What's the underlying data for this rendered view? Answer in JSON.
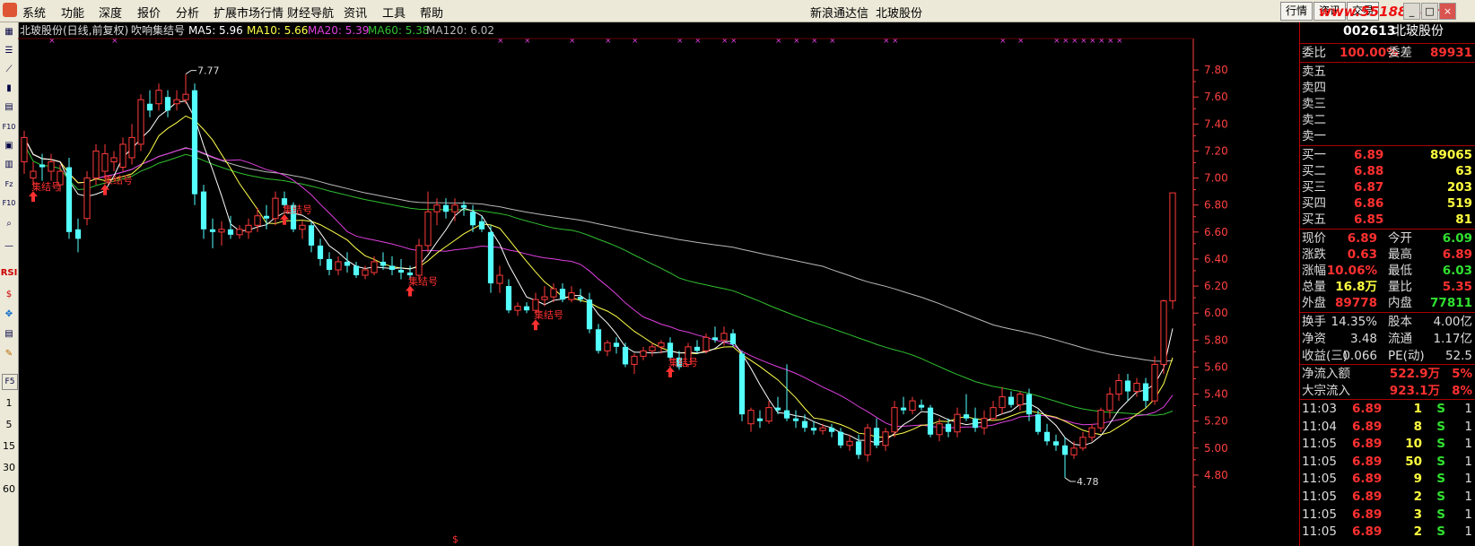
{
  "menu": {
    "items": [
      "系统",
      "功能",
      "深度",
      "报价",
      "分析",
      "扩展市场行情",
      "财经导航",
      "资讯",
      "工具",
      "帮助"
    ],
    "center": [
      "新浪通达信",
      "北玻股份"
    ],
    "right_buttons": [
      "行情",
      "资讯",
      "交易"
    ],
    "watermark": "www.55188.com"
  },
  "toolbar": {
    "icons": [
      "grid-icon",
      "list-icon",
      "line-chart-icon",
      "candle-icon",
      "table-icon",
      "f10-icon",
      "doc-icon",
      "book-icon",
      "f2z-icon",
      "f10b-icon",
      "magnifier-icon",
      "rsi-icon",
      "dollar-icon",
      "move-icon",
      "stack-icon",
      "pencil-icon",
      "f5-icon"
    ],
    "rsi_label": "RSI",
    "periods": [
      "1",
      "5",
      "15",
      "30",
      "60"
    ]
  },
  "chart": {
    "header": {
      "stock": "北玻股份(日线,前复权)",
      "indicator": "吹响集结号",
      "ma5": "MA5: 5.96",
      "ma10": "MA10: 5.66",
      "ma20": "MA20: 5.39",
      "ma60": "MA60: 5.38",
      "ma120": "MA120: 6.02"
    },
    "high_label": "7.77",
    "low_label": "4.78",
    "signal_label": "集结号",
    "dollar_marker": "$",
    "colors": {
      "up": "#ff3a3a",
      "down": "#54ffff",
      "ma5": "#ffffff",
      "ma10": "#ffff4a",
      "ma20": "#e040e0",
      "ma60": "#30c030",
      "ma120": "#b8b8b8",
      "grid": "#5a0000",
      "axis": "#ff4040"
    },
    "y_ticks": [
      "7.80",
      "7.60",
      "7.40",
      "7.20",
      "7.00",
      "6.80",
      "6.60",
      "6.40",
      "6.20",
      "6.00",
      "5.80",
      "5.60",
      "5.40",
      "5.20",
      "5.00",
      "4.80"
    ],
    "signal_days": [
      1,
      9,
      29,
      43,
      57,
      72
    ]
  },
  "chart_data": {
    "type": "candlestick",
    "ylim": [
      4.7,
      7.9
    ],
    "ohlc": [
      [
        7.12,
        7.35,
        7.03,
        7.3
      ],
      [
        7.0,
        7.12,
        6.95,
        7.05
      ],
      [
        7.1,
        7.18,
        6.98,
        7.08
      ],
      [
        7.05,
        7.18,
        6.98,
        7.12
      ],
      [
        6.95,
        7.1,
        6.9,
        7.05
      ],
      [
        7.08,
        7.15,
        6.55,
        6.6
      ],
      [
        6.62,
        6.7,
        6.45,
        6.55
      ],
      [
        6.7,
        7.05,
        6.65,
        7.0
      ],
      [
        7.0,
        7.25,
        6.95,
        7.2
      ],
      [
        7.05,
        7.25,
        7.0,
        7.18
      ],
      [
        7.12,
        7.2,
        7.05,
        7.15
      ],
      [
        7.08,
        7.3,
        7.05,
        7.25
      ],
      [
        7.15,
        7.4,
        7.1,
        7.3
      ],
      [
        7.25,
        7.62,
        7.2,
        7.58
      ],
      [
        7.55,
        7.65,
        7.45,
        7.5
      ],
      [
        7.55,
        7.7,
        7.5,
        7.65
      ],
      [
        7.6,
        7.65,
        7.45,
        7.5
      ],
      [
        7.55,
        7.65,
        7.5,
        7.58
      ],
      [
        7.58,
        7.77,
        7.55,
        7.62
      ],
      [
        7.65,
        7.7,
        6.8,
        6.88
      ],
      [
        6.9,
        6.95,
        6.55,
        6.62
      ],
      [
        6.62,
        6.7,
        6.48,
        6.6
      ],
      [
        6.6,
        6.68,
        6.5,
        6.62
      ],
      [
        6.62,
        6.72,
        6.55,
        6.58
      ],
      [
        6.58,
        6.65,
        6.55,
        6.62
      ],
      [
        6.6,
        6.7,
        6.55,
        6.65
      ],
      [
        6.65,
        6.78,
        6.6,
        6.72
      ],
      [
        6.72,
        6.8,
        6.62,
        6.7
      ],
      [
        6.7,
        6.9,
        6.65,
        6.85
      ],
      [
        6.85,
        6.9,
        6.78,
        6.8
      ],
      [
        6.8,
        6.82,
        6.6,
        6.62
      ],
      [
        6.62,
        6.68,
        6.55,
        6.65
      ],
      [
        6.65,
        6.68,
        6.45,
        6.5
      ],
      [
        6.5,
        6.55,
        6.35,
        6.4
      ],
      [
        6.4,
        6.45,
        6.28,
        6.32
      ],
      [
        6.32,
        6.42,
        6.28,
        6.38
      ],
      [
        6.38,
        6.45,
        6.3,
        6.35
      ],
      [
        6.35,
        6.38,
        6.26,
        6.28
      ],
      [
        6.28,
        6.35,
        6.25,
        6.32
      ],
      [
        6.3,
        6.42,
        6.28,
        6.38
      ],
      [
        6.38,
        6.45,
        6.32,
        6.35
      ],
      [
        6.35,
        6.42,
        6.28,
        6.32
      ],
      [
        6.32,
        6.4,
        6.25,
        6.3
      ],
      [
        6.3,
        6.35,
        6.25,
        6.28
      ],
      [
        6.28,
        6.55,
        6.25,
        6.5
      ],
      [
        6.5,
        6.9,
        6.45,
        6.75
      ],
      [
        6.75,
        6.85,
        6.65,
        6.8
      ],
      [
        6.8,
        6.85,
        6.7,
        6.75
      ],
      [
        6.75,
        6.85,
        6.68,
        6.8
      ],
      [
        6.8,
        6.83,
        6.72,
        6.78
      ],
      [
        6.75,
        6.8,
        6.6,
        6.65
      ],
      [
        6.68,
        6.72,
        6.6,
        6.62
      ],
      [
        6.6,
        6.65,
        6.15,
        6.22
      ],
      [
        6.22,
        6.35,
        6.15,
        6.28
      ],
      [
        6.2,
        6.25,
        6.0,
        6.02
      ],
      [
        6.02,
        6.08,
        5.98,
        6.05
      ],
      [
        6.05,
        6.08,
        6.0,
        6.02
      ],
      [
        6.02,
        6.15,
        6.0,
        6.1
      ],
      [
        6.1,
        6.2,
        6.05,
        6.12
      ],
      [
        6.12,
        6.22,
        6.08,
        6.18
      ],
      [
        6.18,
        6.22,
        6.08,
        6.1
      ],
      [
        6.1,
        6.2,
        6.08,
        6.15
      ],
      [
        6.12,
        6.18,
        6.08,
        6.1
      ],
      [
        6.1,
        6.15,
        5.85,
        5.88
      ],
      [
        5.88,
        5.92,
        5.7,
        5.72
      ],
      [
        5.72,
        5.8,
        5.68,
        5.78
      ],
      [
        5.78,
        5.82,
        5.7,
        5.75
      ],
      [
        5.75,
        5.78,
        5.6,
        5.62
      ],
      [
        5.62,
        5.7,
        5.55,
        5.68
      ],
      [
        5.68,
        5.75,
        5.65,
        5.72
      ],
      [
        5.72,
        5.78,
        5.68,
        5.75
      ],
      [
        5.75,
        5.8,
        5.7,
        5.78
      ],
      [
        5.78,
        5.82,
        5.65,
        5.67
      ],
      [
        5.67,
        5.72,
        5.58,
        5.6
      ],
      [
        5.62,
        5.78,
        5.6,
        5.75
      ],
      [
        5.75,
        5.8,
        5.7,
        5.72
      ],
      [
        5.72,
        5.85,
        5.7,
        5.82
      ],
      [
        5.82,
        5.9,
        5.78,
        5.8
      ],
      [
        5.8,
        5.9,
        5.76,
        5.85
      ],
      [
        5.85,
        5.88,
        5.75,
        5.77
      ],
      [
        5.7,
        5.72,
        5.2,
        5.25
      ],
      [
        5.18,
        5.3,
        5.12,
        5.28
      ],
      [
        5.22,
        5.28,
        5.15,
        5.2
      ],
      [
        5.2,
        5.35,
        5.18,
        5.3
      ],
      [
        5.3,
        5.38,
        5.25,
        5.28
      ],
      [
        5.28,
        5.62,
        5.2,
        5.22
      ],
      [
        5.22,
        5.28,
        5.15,
        5.2
      ],
      [
        5.2,
        5.25,
        5.12,
        5.15
      ],
      [
        5.15,
        5.2,
        5.1,
        5.13
      ],
      [
        5.13,
        5.18,
        5.1,
        5.15
      ],
      [
        5.15,
        5.18,
        5.08,
        5.12
      ],
      [
        5.12,
        5.15,
        5.0,
        5.02
      ],
      [
        5.02,
        5.1,
        4.98,
        5.05
      ],
      [
        5.05,
        5.1,
        4.92,
        4.95
      ],
      [
        4.95,
        5.18,
        4.9,
        5.15
      ],
      [
        5.15,
        5.22,
        5.0,
        5.02
      ],
      [
        5.02,
        5.15,
        4.98,
        5.12
      ],
      [
        5.12,
        5.35,
        5.08,
        5.3
      ],
      [
        5.3,
        5.38,
        5.25,
        5.28
      ],
      [
        5.28,
        5.38,
        5.25,
        5.35
      ],
      [
        5.32,
        5.36,
        5.28,
        5.3
      ],
      [
        5.3,
        5.32,
        5.08,
        5.1
      ],
      [
        5.1,
        5.22,
        5.05,
        5.18
      ],
      [
        5.18,
        5.22,
        5.08,
        5.12
      ],
      [
        5.12,
        5.3,
        5.08,
        5.25
      ],
      [
        5.25,
        5.4,
        5.2,
        5.22
      ],
      [
        5.22,
        5.3,
        5.12,
        5.15
      ],
      [
        5.15,
        5.28,
        5.1,
        5.22
      ],
      [
        5.22,
        5.35,
        5.2,
        5.3
      ],
      [
        5.3,
        5.45,
        5.25,
        5.38
      ],
      [
        5.38,
        5.42,
        5.3,
        5.32
      ],
      [
        5.32,
        5.42,
        5.28,
        5.4
      ],
      [
        5.4,
        5.44,
        5.2,
        5.25
      ],
      [
        5.25,
        5.28,
        5.1,
        5.12
      ],
      [
        5.12,
        5.18,
        5.02,
        5.05
      ],
      [
        5.05,
        5.1,
        4.98,
        5.02
      ],
      [
        5.02,
        5.08,
        4.78,
        4.95
      ],
      [
        4.95,
        5.05,
        4.92,
        5.0
      ],
      [
        5.0,
        5.12,
        4.98,
        5.08
      ],
      [
        5.08,
        5.18,
        5.05,
        5.15
      ],
      [
        5.15,
        5.3,
        5.12,
        5.28
      ],
      [
        5.28,
        5.45,
        5.22,
        5.4
      ],
      [
        5.4,
        5.55,
        5.35,
        5.5
      ],
      [
        5.5,
        5.55,
        5.35,
        5.42
      ],
      [
        5.42,
        5.52,
        5.38,
        5.48
      ],
      [
        5.48,
        5.52,
        5.3,
        5.35
      ],
      [
        5.35,
        5.68,
        5.32,
        5.62
      ],
      [
        5.62,
        6.1,
        5.55,
        6.09
      ],
      [
        6.09,
        6.89,
        6.03,
        6.89
      ]
    ],
    "ma5_last": 5.96,
    "ma10_last": 5.66,
    "ma20_last": 5.39,
    "ma60_last": 5.38,
    "ma120_last": 6.02
  },
  "panel": {
    "code": "002613",
    "name": "北玻股份",
    "weibi_label": "委比",
    "weibi_value": "100.00%",
    "weicha_label": "委差",
    "weicha_value": "89931",
    "sells": [
      {
        "label": "卖五",
        "price": "",
        "vol": ""
      },
      {
        "label": "卖四",
        "price": "",
        "vol": ""
      },
      {
        "label": "卖三",
        "price": "",
        "vol": ""
      },
      {
        "label": "卖二",
        "price": "",
        "vol": ""
      },
      {
        "label": "卖一",
        "price": "",
        "vol": ""
      }
    ],
    "buys": [
      {
        "label": "买一",
        "price": "6.89",
        "vol": "89065"
      },
      {
        "label": "买二",
        "price": "6.88",
        "vol": "63"
      },
      {
        "label": "买三",
        "price": "6.87",
        "vol": "203"
      },
      {
        "label": "买四",
        "price": "6.86",
        "vol": "519"
      },
      {
        "label": "买五",
        "price": "6.85",
        "vol": "81"
      }
    ],
    "stats": [
      {
        "l1": "现价",
        "v1": "6.89",
        "c1": "#ff3030",
        "l2": "今开",
        "v2": "6.09",
        "c2": "#30e030"
      },
      {
        "l1": "涨跌",
        "v1": "0.63",
        "c1": "#ff3030",
        "l2": "最高",
        "v2": "6.89",
        "c2": "#ff3030"
      },
      {
        "l1": "涨幅",
        "v1": "10.06%",
        "c1": "#ff3030",
        "l2": "最低",
        "v2": "6.03",
        "c2": "#30e030"
      },
      {
        "l1": "总量",
        "v1": "16.8万",
        "c1": "#ffff40",
        "l2": "量比",
        "v2": "5.35",
        "c2": "#ff3030"
      },
      {
        "l1": "外盘",
        "v1": "89778",
        "c1": "#ff3030",
        "l2": "内盘",
        "v2": "77811",
        "c2": "#30e030"
      }
    ],
    "fund": [
      {
        "l1": "换手",
        "v1": "14.35%",
        "l2": "股本",
        "v2": "4.00亿"
      },
      {
        "l1": "净资",
        "v1": "3.48",
        "l2": "流通",
        "v2": "1.17亿"
      },
      {
        "l1": "收益(三)",
        "v1": "0.066",
        "l2": "PE(动)",
        "v2": "52.5"
      }
    ],
    "flow": [
      {
        "label": "净流入额",
        "value": "522.9万",
        "pct": "5%"
      },
      {
        "label": "大宗流入",
        "value": "923.1万",
        "pct": "8%"
      }
    ],
    "ticks": [
      {
        "time": "11:03",
        "price": "6.89",
        "vol": "1",
        "bs": "S",
        "n": "1"
      },
      {
        "time": "11:04",
        "price": "6.89",
        "vol": "8",
        "bs": "S",
        "n": "1"
      },
      {
        "time": "11:05",
        "price": "6.89",
        "vol": "10",
        "bs": "S",
        "n": "1"
      },
      {
        "time": "11:05",
        "price": "6.89",
        "vol": "50",
        "bs": "S",
        "n": "1"
      },
      {
        "time": "11:05",
        "price": "6.89",
        "vol": "9",
        "bs": "S",
        "n": "1"
      },
      {
        "time": "11:05",
        "price": "6.89",
        "vol": "2",
        "bs": "S",
        "n": "1"
      },
      {
        "time": "11:05",
        "price": "6.89",
        "vol": "3",
        "bs": "S",
        "n": "1"
      },
      {
        "time": "11:05",
        "price": "6.89",
        "vol": "2",
        "bs": "S",
        "n": "1"
      }
    ]
  }
}
